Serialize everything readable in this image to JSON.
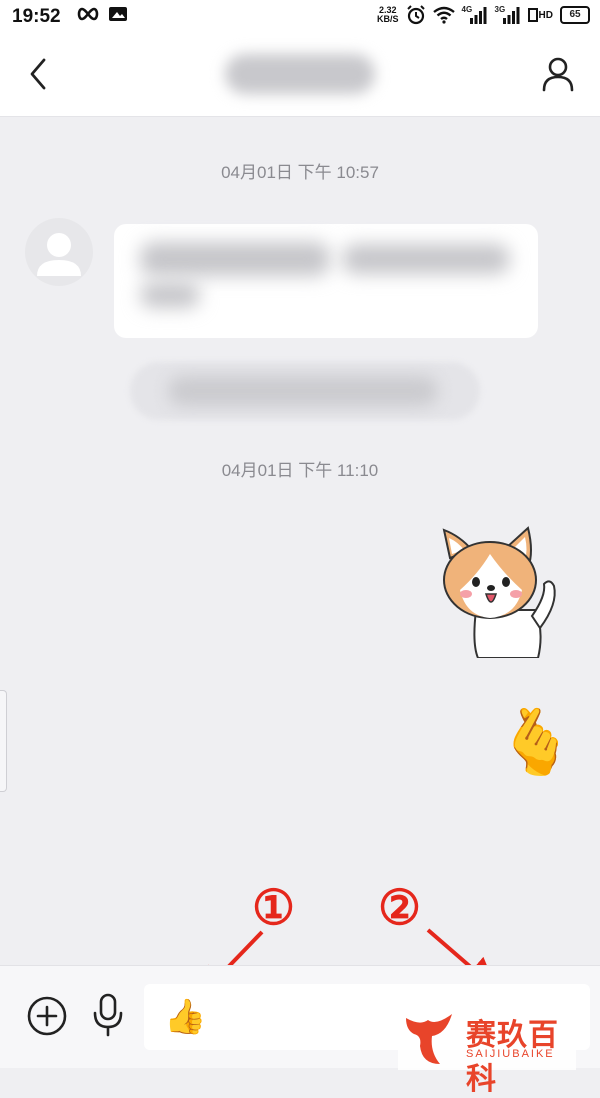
{
  "status_bar": {
    "time": "19:52",
    "net_speed_value": "2.32",
    "net_speed_unit": "KB/S",
    "signal_1_label": "4G",
    "signal_2_label": "3G",
    "hd_label": "HD",
    "battery": "65"
  },
  "nav": {
    "back_icon": "chevron-left-icon",
    "profile_icon": "person-icon"
  },
  "chat": {
    "timestamp_1": "04月01日 下午 10:57",
    "timestamp_2": "04月01日 下午 11:10",
    "sent_sticker": "corgi-waving-sticker",
    "sent_emoji": "🫰"
  },
  "annotations": {
    "label_1": "①",
    "label_2": "②",
    "color": "#e5271c"
  },
  "input_bar": {
    "plus_icon": "plus-circle-icon",
    "mic_icon": "microphone-icon",
    "input_value": "👍"
  },
  "watermark": {
    "brand": "赛玖百科",
    "brand_sub": "SAIJIUBAIKE"
  }
}
